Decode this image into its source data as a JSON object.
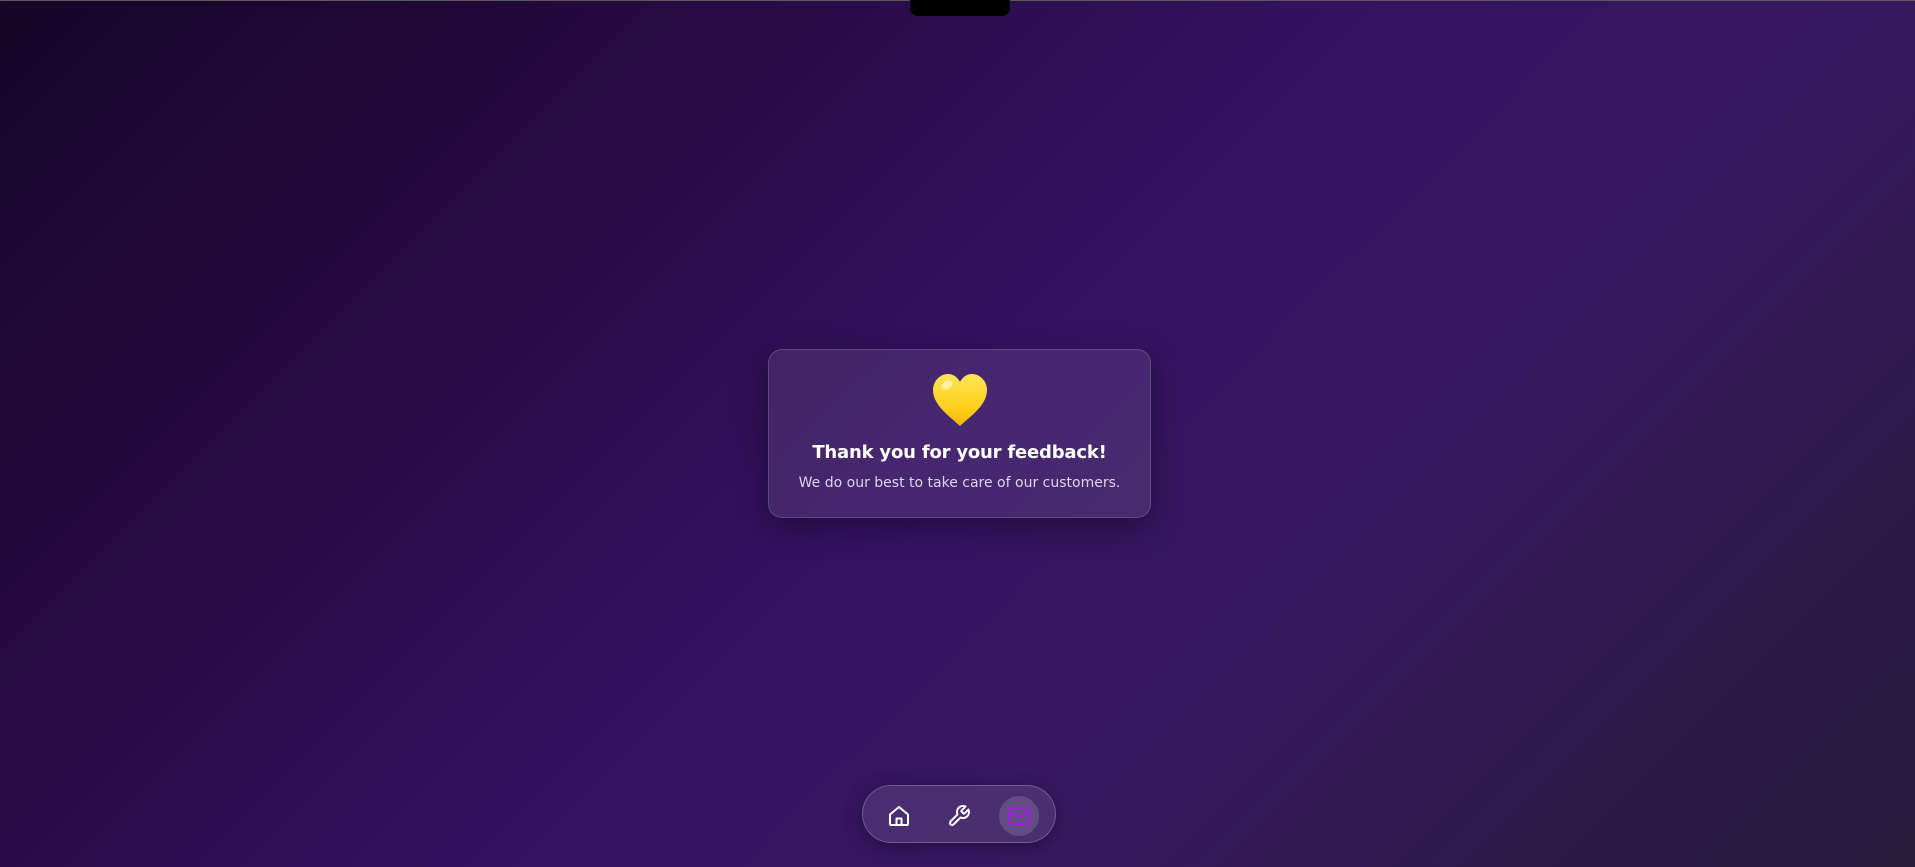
{
  "feedback_card": {
    "icon": "yellow-heart-icon",
    "title": "Thank you for your feedback!",
    "message": "We do our best to take care of our customers."
  },
  "dock": {
    "items": [
      {
        "icon": "home-icon",
        "active": false
      },
      {
        "icon": "wrench-icon",
        "active": false
      },
      {
        "icon": "mail-icon",
        "active": true
      }
    ]
  },
  "colors": {
    "accent": "#a01ee0",
    "heart": "#ffd21f",
    "text_primary": "#ffffff",
    "text_secondary": "#ddd4ea"
  }
}
